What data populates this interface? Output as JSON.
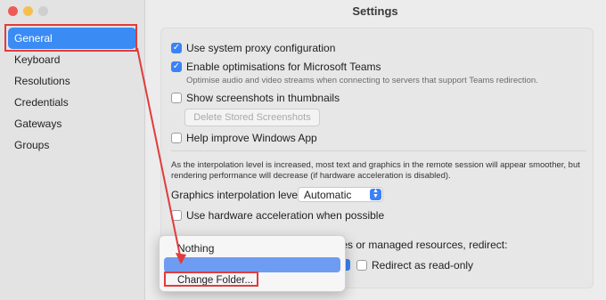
{
  "window": {
    "title": "Settings"
  },
  "sidebar": {
    "items": [
      {
        "label": "General",
        "selected": true
      },
      {
        "label": "Keyboard"
      },
      {
        "label": "Resolutions"
      },
      {
        "label": "Credentials"
      },
      {
        "label": "Gateways"
      },
      {
        "label": "Groups"
      }
    ]
  },
  "general": {
    "proxy_label": "Use system proxy configuration",
    "proxy_checked": true,
    "teams_label": "Enable optimisations for Microsoft Teams",
    "teams_checked": true,
    "teams_desc": "Optimise audio and video streams when connecting to servers that support Teams redirection.",
    "screenshots_label": "Show screenshots in thumbnails",
    "screenshots_checked": false,
    "delete_screenshots_label": "Delete Stored Screenshots",
    "help_label": "Help improve Windows App",
    "help_checked": false,
    "interp_note": "As the interpolation level is increased, most text and graphics in the remote session will appear smoother, but rendering performance will decrease (if hardware acceleration is disabled).",
    "interp_label": "Graphics interpolation level:",
    "interp_value": "Automatic",
    "hw_label": "Use hardware acceleration when possible",
    "hw_checked": false,
    "redirect_partial": "iles or managed resources, redirect:",
    "readonly_label": "Redirect as read-only",
    "readonly_checked": false
  },
  "popup_menu": {
    "item_nothing": "Nothing",
    "item_change_folder": "Change Folder..."
  },
  "colors": {
    "accent": "#3b82f6",
    "annotation": "#e23b3b",
    "selection": "#3b8bf5"
  }
}
